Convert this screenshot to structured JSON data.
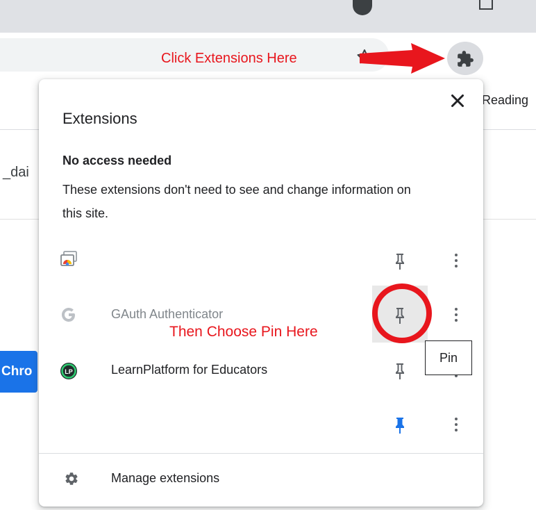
{
  "annotations": {
    "top_hint": "Click Extensions Here",
    "middle_hint": "Then Choose Pin Here"
  },
  "browser": {
    "reading_list_label": "Reading",
    "page_fragment": "_dai",
    "page_button_fragment": "Chro"
  },
  "popup": {
    "title": "Extensions",
    "section": {
      "heading": "No access needed",
      "description": "These extensions don't need to see and change information on this site."
    },
    "extensions": [
      {
        "name": "",
        "icon": "chrome-remote-icon",
        "pinned": false
      },
      {
        "name": "GAuth Authenticator",
        "icon": "google-g-icon",
        "pinned": false
      },
      {
        "name": "LearnPlatform for Educators",
        "icon": "learnplatform-icon",
        "pinned": false
      },
      {
        "name": "",
        "icon": "blank-icon",
        "pinned": true
      }
    ],
    "tooltip": "Pin",
    "manage_label": "Manage extensions"
  },
  "colors": {
    "annotation_red": "#e8161d",
    "pinned_blue": "#1a73e8",
    "icon_gray": "#5f6368"
  }
}
